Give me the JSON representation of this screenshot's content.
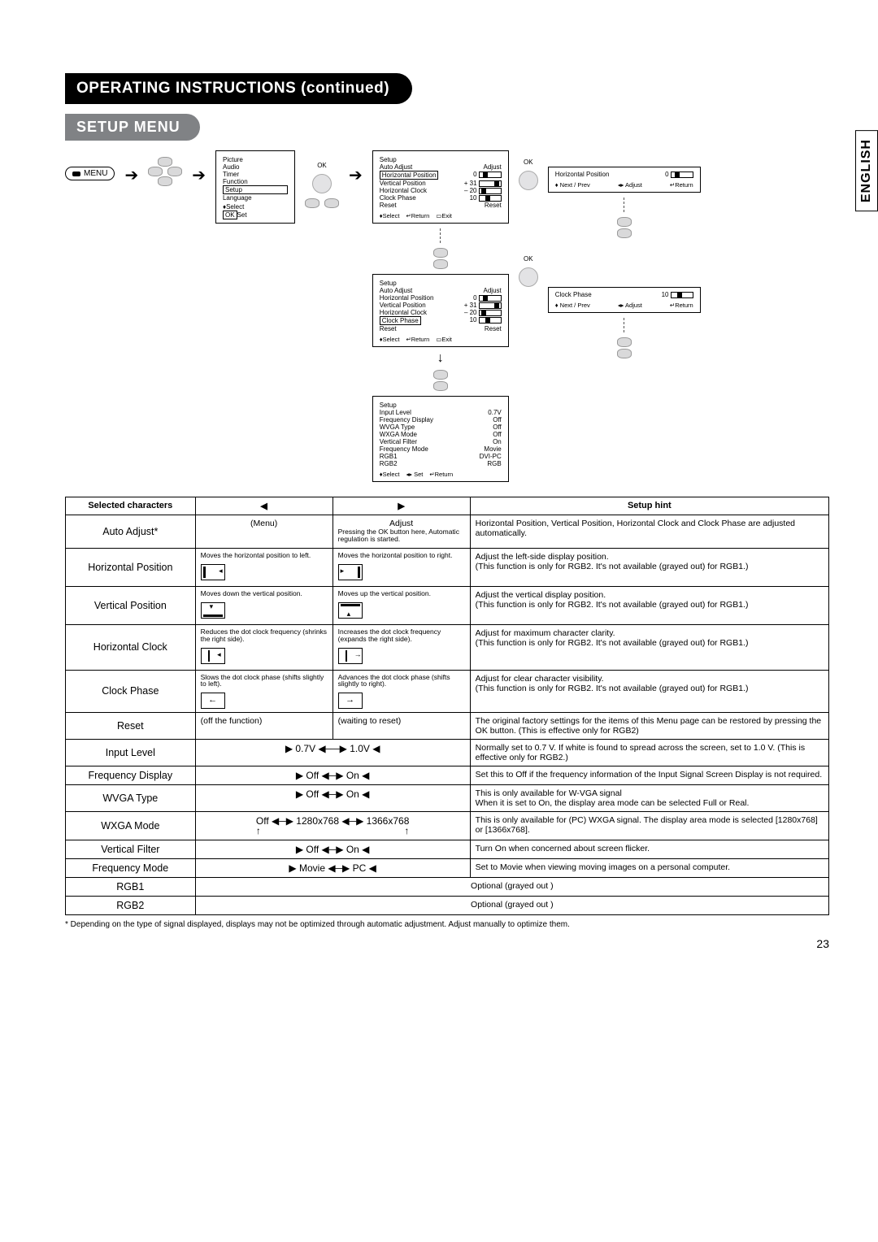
{
  "lang_tab": "ENGLISH",
  "title": "OPERATING INSTRUCTIONS (continued)",
  "subtitle": "SETUP MENU",
  "menu_button": "MENU",
  "ok_label": "OK",
  "main_menu": {
    "items": [
      "Picture",
      "Audio",
      "Timer",
      "Function",
      "Setup",
      "Language"
    ],
    "highlight": "Setup",
    "foot_select": "Select",
    "foot_set": "Set",
    "foot_set_box": "OK"
  },
  "osd1": {
    "title": "Setup",
    "rows": [
      {
        "name": "Auto Adjust",
        "val": "Adjust"
      },
      {
        "name": "Horizontal Position",
        "val": "0",
        "slider": 20,
        "hl": true
      },
      {
        "name": "Vertical Position",
        "val": "+ 31",
        "slider": 70
      },
      {
        "name": "Horizontal Clock",
        "val": "– 20",
        "slider": 10
      },
      {
        "name": "Clock Phase",
        "val": "10",
        "slider": 30
      },
      {
        "name": "Reset",
        "val": "Reset"
      }
    ],
    "foot": [
      "Select",
      "Return",
      "Exit"
    ]
  },
  "osd2": {
    "title": "Setup",
    "rows": [
      {
        "name": "Auto Adjust",
        "val": "Adjust"
      },
      {
        "name": "Horizontal Position",
        "val": "0",
        "slider": 20
      },
      {
        "name": "Vertical Position",
        "val": "+ 31",
        "slider": 70
      },
      {
        "name": "Horizontal Clock",
        "val": "– 20",
        "slider": 10
      },
      {
        "name": "Clock Phase",
        "val": "10",
        "slider": 30,
        "hl": true
      },
      {
        "name": "Reset",
        "val": "Reset"
      }
    ],
    "foot": [
      "Select",
      "Return",
      "Exit"
    ]
  },
  "osd3": {
    "title": "Setup",
    "rows": [
      {
        "name": "Input Level",
        "val": "0.7V"
      },
      {
        "name": "Frequency Display",
        "val": "Off"
      },
      {
        "name": "WVGA Type",
        "val": "Off"
      },
      {
        "name": "WXGA Mode",
        "val": "Off"
      },
      {
        "name": "Vertical Filter",
        "val": "On"
      },
      {
        "name": "Frequency Mode",
        "val": "Movie"
      },
      {
        "name": "RGB1",
        "val": "DVI-PC"
      },
      {
        "name": "RGB2",
        "val": "RGB"
      }
    ],
    "foot": [
      "Select",
      "Set",
      "Return"
    ]
  },
  "adj_box1": {
    "name": "Horizontal Position",
    "val": "0",
    "foot_l": "Next / Prev",
    "foot_m": "Adjust",
    "foot_r": "Return"
  },
  "adj_box2": {
    "name": "Clock Phase",
    "val": "10",
    "foot_l": "Next / Prev",
    "foot_m": "Adjust",
    "foot_r": "Return"
  },
  "table": {
    "head": {
      "c1": "Selected characters",
      "c2": "◀",
      "c3": "▶",
      "c4": "Setup hint"
    },
    "rows": [
      {
        "name": "Auto Adjust*",
        "left": "(Menu)",
        "right": "Adjust",
        "right_sub": "Pressing the OK button here, Automatic regulation is started.",
        "hint": "Horizontal Position, Vertical Position, Horizontal Clock and Clock Phase are adjusted automatically."
      },
      {
        "name": "Horizontal Position",
        "left": "Moves the horizontal position to left.",
        "right": "Moves the horizontal position to right.",
        "hint": "Adjust the left-side display position.\n(This function is only for RGB2. It's not available (grayed out) for RGB1.)",
        "icons": true
      },
      {
        "name": "Vertical Position",
        "left": "Moves down the vertical position.",
        "right": "Moves up the vertical position.",
        "hint": "Adjust the vertical display position.\n(This function is only for RGB2. It's not available (grayed out) for RGB1.)",
        "icons": true
      },
      {
        "name": "Horizontal Clock",
        "left": "Reduces the dot clock frequency (shrinks the right side).",
        "right": "Increases the dot clock frequency (expands the right side).",
        "hint": "Adjust for maximum character clarity.\n(This function is only for RGB2. It's not available (grayed out) for RGB1.)",
        "icons": true
      },
      {
        "name": "Clock Phase",
        "left": "Slows the dot clock phase (shifts slightly to left).",
        "right": "Advances the dot clock phase (shifts slightly to right).",
        "hint": "Adjust for clear character visibility.\n(This function is only for RGB2. It's not available (grayed out) for RGB1.)",
        "icons": true
      },
      {
        "name": "Reset",
        "left": "(off the function)",
        "right": "(waiting to reset)",
        "hint": "The original factory settings for the items of this Menu page can be restored by pressing the OK button.   (This is effective only for RGB2)"
      },
      {
        "name": "Input Level",
        "range": "▶ 0.7V ◀──▶ 1.0V ◀",
        "hint": "Normally set to 0.7 V. If white is found to spread across the screen, set to 1.0 V. (This is effective only for RGB2.)"
      },
      {
        "name": "Frequency Display",
        "range": "▶ Off ◀─▶ On ◀",
        "hint": "Set this to Off if the frequency information of the Input Signal Screen Display is not required."
      },
      {
        "name": "WVGA Type",
        "range": "▶ Off ◀─▶ On ◀",
        "hint": "This is only available for W-VGA signal\nWhen it is set to On, the display area mode can be selected Full or Real."
      },
      {
        "name": "WXGA Mode",
        "range": "Off ◀─▶ 1280x768 ◀─▶ 1366x768",
        "hint": "This is only available for (PC) WXGA signal. The display area mode is selected [1280x768] or [1366x768]."
      },
      {
        "name": "Vertical Filter",
        "range": "▶ Off ◀─▶ On ◀",
        "hint": "Turn On when concerned about screen flicker."
      },
      {
        "name": "Frequency Mode",
        "range": "▶ Movie ◀─▶ PC ◀",
        "hint": "Set to Movie when viewing moving images on a personal computer."
      },
      {
        "name": "RGB1",
        "gray": "Optional (grayed out )"
      },
      {
        "name": "RGB2",
        "gray": "Optional (grayed out )"
      }
    ]
  },
  "footnote": "*  Depending on the type of signal displayed, displays may not be optimized through automatic adjustment. Adjust manually to optimize them.",
  "page_number": "23"
}
